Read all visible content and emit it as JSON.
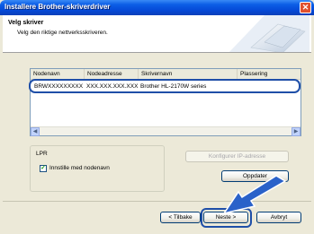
{
  "window": {
    "title": "Installere Brother-skriverdriver"
  },
  "header": {
    "title": "Velg skriver",
    "subtitle": "Velg den riktige nettverksskriveren."
  },
  "printer_list": {
    "columns": [
      "Nodenavn",
      "Nodeadresse",
      "Skrivernavn",
      "Plassering"
    ],
    "rows": [
      {
        "node_name": "BRWXXXXXXXXX",
        "node_address": "XXX.XXX.XXX.XXX",
        "printer_name": "Brother HL-2170W series",
        "location": ""
      }
    ]
  },
  "lpr": {
    "group_label": "LPR",
    "checkbox_label": "Innstille med nodenavn",
    "checked": true
  },
  "buttons": {
    "configure_ip": "Konfigurer IP-adresse",
    "refresh": "Oppdater",
    "back": "< Tilbake",
    "next": "Neste >",
    "cancel": "Avbryt"
  },
  "colors": {
    "titlebar": "#0548d6",
    "highlight": "#1f4fa8",
    "arrow": "#2a62c9"
  }
}
